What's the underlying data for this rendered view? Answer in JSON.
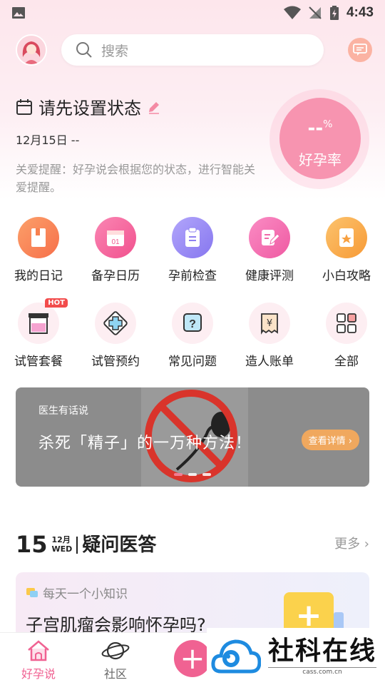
{
  "status_bar": {
    "time": "4:43"
  },
  "header": {
    "search_placeholder": "搜索"
  },
  "status_card": {
    "title": "请先设置状态",
    "date": "12月15日 --",
    "tip": "关爱提醒：好孕说会根据您的状态，进行智能关爱提醒。"
  },
  "pregnancy_rate": {
    "value": "--",
    "unit": "%",
    "label": "好孕率"
  },
  "grid_row1": [
    {
      "label": "我的日记",
      "icon": "diary-book-icon",
      "color": "#f98b5a"
    },
    {
      "label": "备孕日历",
      "icon": "calendar-icon",
      "color": "#f56aa0"
    },
    {
      "label": "孕前检查",
      "icon": "clipboard-icon",
      "color": "#9b8ef5"
    },
    {
      "label": "健康评测",
      "icon": "edit-form-icon",
      "color": "#f46fb0"
    },
    {
      "label": "小白攻略",
      "icon": "bookmark-star-icon",
      "color": "#f8a84a"
    }
  ],
  "grid_row2": [
    {
      "label": "试管套餐",
      "icon": "test-tube-box-icon",
      "badge": "HOT"
    },
    {
      "label": "试管预约",
      "icon": "medical-cross-icon"
    },
    {
      "label": "常见问题",
      "icon": "question-icon"
    },
    {
      "label": "造人账单",
      "icon": "receipt-yen-icon"
    },
    {
      "label": "全部",
      "icon": "grid-all-icon"
    }
  ],
  "banner": {
    "subtitle": "医生有话说",
    "headline": "杀死「精子」的一万种方法！",
    "button": "查看详情 ›"
  },
  "qa_section": {
    "day": "15",
    "month": "12月",
    "weekday": "WED",
    "title": "疑问医答",
    "more": "更多 ›"
  },
  "knowledge_card": {
    "tag": "每天一个小知识",
    "question": "子宫肌瘤会影响怀孕吗?",
    "plus": "+"
  },
  "tabbar": {
    "tabs": [
      {
        "label": "好孕说",
        "active": true
      },
      {
        "label": "社区",
        "active": false
      },
      {
        "label": "",
        "center_button": "+"
      }
    ]
  },
  "watermark": {
    "text": "社科在线",
    "url": "cass.com.cn"
  },
  "colors": {
    "brand_pink": "#f06292",
    "header_bg": "#fde6ec"
  }
}
